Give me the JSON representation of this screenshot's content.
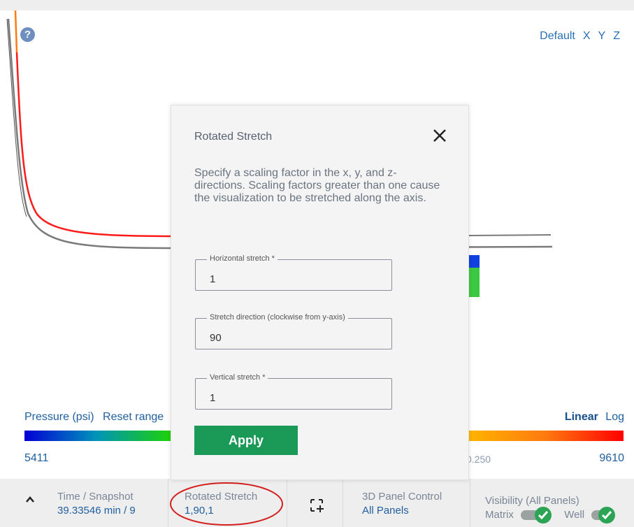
{
  "viewport": {
    "help_glyph": "?",
    "axis_views": [
      "Default",
      "X",
      "Y",
      "Z"
    ]
  },
  "legend": {
    "variable_label": "Pressure (psi)",
    "reset_label": "Reset range",
    "scale_active": "Linear",
    "scale_other": "Log",
    "min_value": "5411",
    "mid_value": "0.250",
    "max_value": "9610",
    "colors": {
      "low": "#0000d6",
      "mid": "#c8e600",
      "high": "#ff0000"
    }
  },
  "modal": {
    "title": "Rotated Stretch",
    "description": "Specify a scaling factor in the x, y, and z-directions. Scaling factors greater than one cause the visualization to be stretched along the axis.",
    "fields": [
      {
        "label": "Horizontal stretch *",
        "value": "1"
      },
      {
        "label": "Stretch direction (clockwise from y-axis)",
        "value": "90"
      },
      {
        "label": "Vertical stretch *",
        "value": "1"
      }
    ],
    "apply_label": "Apply",
    "apply_color": "#1b9a57"
  },
  "bottombar": {
    "time": {
      "label": "Time / Snapshot",
      "value": "39.33546 min / 9"
    },
    "stretch": {
      "label": "Rotated Stretch",
      "value": "1,90,1"
    },
    "panel": {
      "label": "3D Panel Control",
      "value": "All Panels"
    },
    "visibility": {
      "label": "Visibility (All Panels)",
      "matrix_label": "Matrix",
      "well_label": "Well"
    }
  }
}
